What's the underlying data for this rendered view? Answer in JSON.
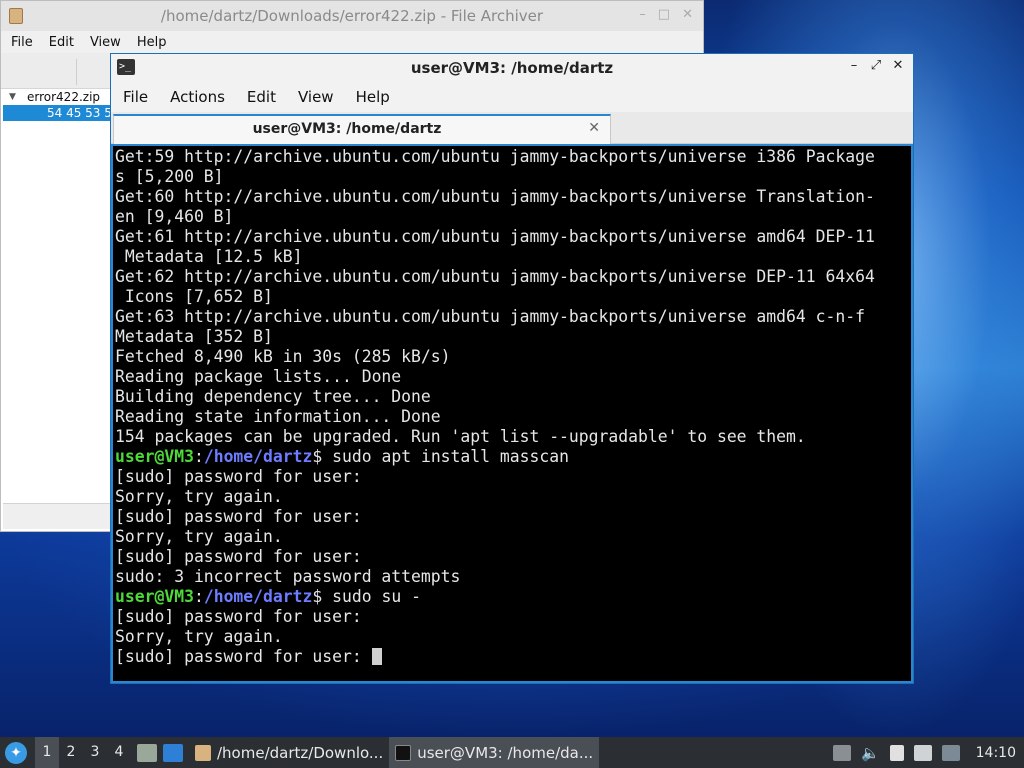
{
  "archiver": {
    "title": "/home/dartz/Downloads/error422.zip - File Archiver",
    "window_buttons": [
      "–",
      "□",
      "✕"
    ],
    "menu": [
      "File",
      "Edit",
      "View",
      "Help"
    ],
    "tree": {
      "root": "error422.zip",
      "selected": "54 45 53 5"
    }
  },
  "terminal": {
    "title": "user@VM3: /home/dartz",
    "window_buttons": [
      "–",
      "⤢",
      "✕"
    ],
    "menu": [
      "File",
      "Actions",
      "Edit",
      "View",
      "Help"
    ],
    "tab": {
      "label": "user@VM3: /home/dartz",
      "close": "✕"
    },
    "lines": [
      "Get:59 http://archive.ubuntu.com/ubuntu jammy-backports/universe i386 Package",
      "s [5,200 B]",
      "Get:60 http://archive.ubuntu.com/ubuntu jammy-backports/universe Translation-",
      "en [9,460 B]",
      "Get:61 http://archive.ubuntu.com/ubuntu jammy-backports/universe amd64 DEP-11",
      " Metadata [12.5 kB]",
      "Get:62 http://archive.ubuntu.com/ubuntu jammy-backports/universe DEP-11 64x64",
      " Icons [7,652 B]",
      "Get:63 http://archive.ubuntu.com/ubuntu jammy-backports/universe amd64 c-n-f",
      "Metadata [352 B]",
      "Fetched 8,490 kB in 30s (285 kB/s)",
      "Reading package lists... Done",
      "Building dependency tree... Done",
      "Reading state information... Done",
      "154 packages can be upgraded. Run 'apt list --upgradable' to see them."
    ],
    "prompt": {
      "user_host": "user@VM3",
      "colon": ":",
      "path": "/home/dartz",
      "symbol": "$"
    },
    "cmd1": " sudo apt install masscan",
    "lines2": [
      "[sudo] password for user:",
      "Sorry, try again.",
      "[sudo] password for user:",
      "Sorry, try again.",
      "[sudo] password for user:",
      "sudo: 3 incorrect password attempts"
    ],
    "cmd2": " sudo su -",
    "lines3": [
      "[sudo] password for user:",
      "Sorry, try again."
    ],
    "last_line": "[sudo] password for user: "
  },
  "taskbar": {
    "start_icon": "start-menu-icon",
    "workspaces": [
      "1",
      "2",
      "3",
      "4"
    ],
    "tasks": [
      {
        "label": "/home/dartz/Downlo...",
        "icon": "archive-icon"
      },
      {
        "label": "user@VM3: /home/da...",
        "icon": "terminal-icon"
      }
    ],
    "clock": "14:10"
  }
}
